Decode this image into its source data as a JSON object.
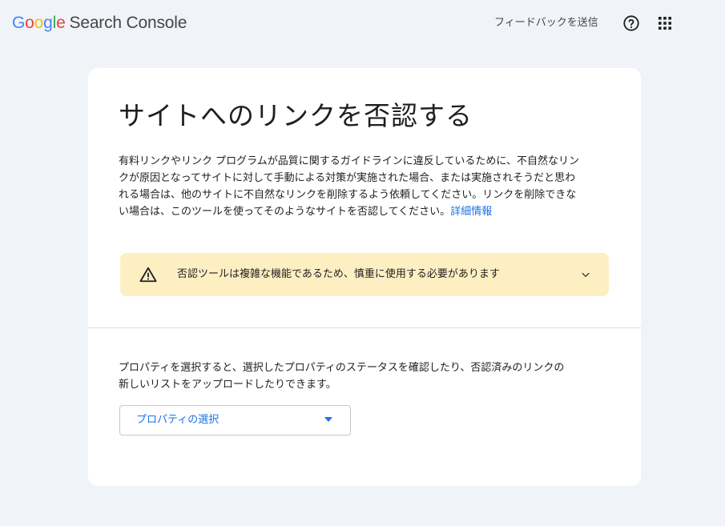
{
  "header": {
    "logo_letters": [
      "G",
      "o",
      "o",
      "g",
      "l",
      "e"
    ],
    "product_name": "Search Console",
    "feedback_label": "フィードバックを送信",
    "help_icon": "help-circle-icon",
    "apps_icon": "apps-grid-icon"
  },
  "card": {
    "title": "サイトへのリンクを否認する",
    "description": "有料リンクやリンク プログラムが品質に関するガイドラインに違反しているために、不自然なリンクが原因となってサイトに対して手動による対策が実施された場合、または実施されそうだと思われる場合は、他のサイトに不自然なリンクを削除するよう依頼してください。リンクを削除できない場合は、このツールを使ってそのようなサイトを否認してください。",
    "learn_more_label": "詳細情報",
    "warning": {
      "icon": "warning-triangle-icon",
      "text": "否認ツールは複雑な機能であるため、慎重に使用する必要があります",
      "chevron_icon": "chevron-down-icon",
      "background_color": "#feefc3"
    },
    "property_description_line1": "プロパティを選択すると、選択したプロパティのステータスを確認したり、否認済みのリンクの",
    "property_description_line2": "新しいリストをアップロードしたりできます。",
    "property_select": {
      "selected_label": "プロパティの選択",
      "arrow_icon": "dropdown-arrow-icon"
    }
  },
  "colors": {
    "page_background": "#f0f4f9",
    "accent": "#1a73e8"
  }
}
